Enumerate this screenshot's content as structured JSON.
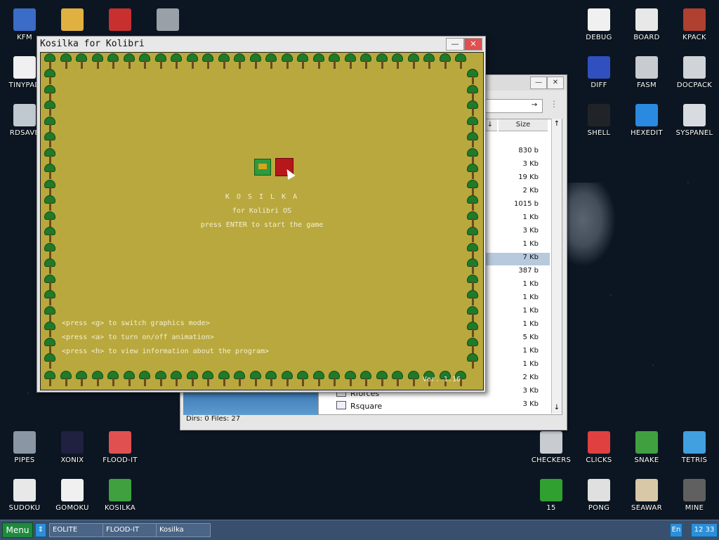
{
  "desktop": {
    "icons": [
      {
        "label": "KFM",
        "icon": "floppy-icon"
      },
      {
        "label": "",
        "icon": "folder-icon"
      },
      {
        "label": "",
        "icon": "notebook-icon"
      },
      {
        "label": "",
        "icon": "calculator-icon"
      },
      {
        "label": "TINYPAD",
        "icon": "notepad-icon"
      },
      {
        "label": "RDSAVE",
        "icon": "disk-save-icon"
      },
      {
        "label": "DEBUG",
        "icon": "debug-icon"
      },
      {
        "label": "BOARD",
        "icon": "board-icon"
      },
      {
        "label": "KPACK",
        "icon": "tools-icon"
      },
      {
        "label": "DIFF",
        "icon": "diff-icon"
      },
      {
        "label": "FASM",
        "icon": "fasm-icon"
      },
      {
        "label": "DOCPACK",
        "icon": "cabinet-icon"
      },
      {
        "label": "SHELL",
        "icon": "terminal-icon"
      },
      {
        "label": "HEXEDIT",
        "icon": "hex-icon"
      },
      {
        "label": "SYSPANEL",
        "icon": "sliders-icon"
      },
      {
        "label": "PIPES",
        "icon": "pipes-icon"
      },
      {
        "label": "XONIX",
        "icon": "xonix-icon"
      },
      {
        "label": "FLOOD-IT",
        "icon": "flood-icon"
      },
      {
        "label": "SUDOKU",
        "icon": "sudoku-icon"
      },
      {
        "label": "GOMOKU",
        "icon": "gomoku-icon"
      },
      {
        "label": "KOSILKA",
        "icon": "lawnmower-icon"
      },
      {
        "label": "CHECKERS",
        "icon": "checkers-icon"
      },
      {
        "label": "CLICKS",
        "icon": "clicks-icon"
      },
      {
        "label": "SNAKE",
        "icon": "snake-icon"
      },
      {
        "label": "TETRIS",
        "icon": "tetris-icon"
      },
      {
        "label": "15",
        "icon": "fifteen-icon"
      },
      {
        "label": "PONG",
        "icon": "pong-icon"
      },
      {
        "label": "SEAWAR",
        "icon": "seawar-icon"
      },
      {
        "label": "MINE",
        "icon": "mine-icon"
      }
    ]
  },
  "file_manager": {
    "column_size_label": "Size",
    "sort_arrow": "↓",
    "sort_arrow_up": "↑",
    "sizes": [
      "830 b",
      "3 Kb",
      "19 Kb",
      "2 Kb",
      "1015 b",
      "1 Kb",
      "3 Kb",
      "1 Kb",
      "7 Kb",
      "387 b",
      "1 Kb",
      "1 Kb",
      "1 Kb",
      "1 Kb",
      "5 Kb",
      "1 Kb",
      "1 Kb",
      "2 Kb",
      "3 Kb",
      "3 Kb"
    ],
    "files": [
      "Rforces",
      "Rsquare"
    ],
    "status": "Dirs: 0   Files: 27",
    "go_label": "→",
    "menu_dots": "⋮"
  },
  "game_window": {
    "title": "Kosilka for Kolibri",
    "min_label": "—",
    "close_label": "✕",
    "game_title": "K O S I L K A",
    "subtitle": "for Kolibri OS",
    "start_prompt": "press ENTER to start the game",
    "hints": [
      "<press <g> to switch graphics mode>",
      "<press <a> to turn on/off animation>",
      "<press <h> to view information about the program>"
    ],
    "version": "Ver. 1.16"
  },
  "taskbar": {
    "menu_label": "Menu",
    "switch_label": "⇕",
    "tasks": [
      "EOLITE",
      "FLOOD-IT",
      "Kosilka"
    ],
    "lang": "En",
    "time": "12 33"
  }
}
